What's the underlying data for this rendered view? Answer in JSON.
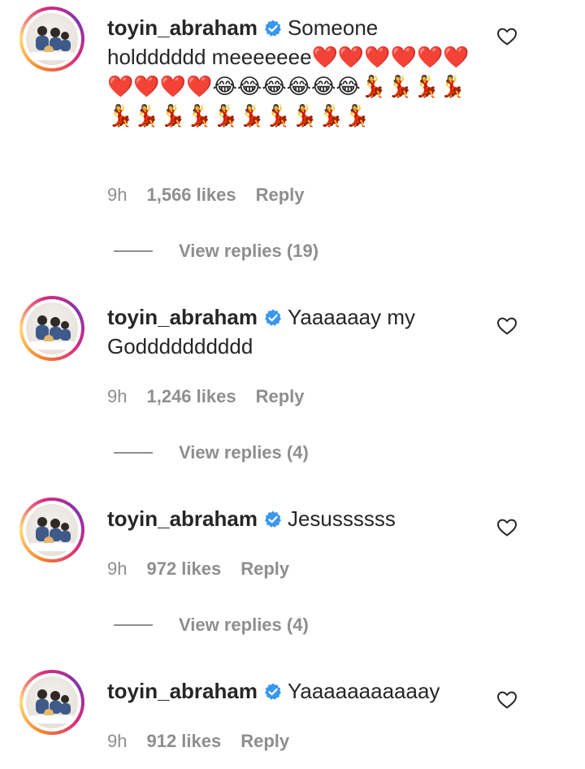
{
  "comments": [
    {
      "username": "toyin_abraham",
      "verified": true,
      "text": "Someone holdddddd meeeeeee❤️❤️❤️❤️❤️❤️❤️❤️❤️❤️😂😂😂😂😂😂💃💃💃💃💃💃💃💃💃💃💃💃💃💃",
      "time": "9h",
      "likes": "1,566 likes",
      "reply_label": "Reply",
      "view_replies": "View replies (19)",
      "like_icon": "heart-outline-icon"
    },
    {
      "username": "toyin_abraham",
      "verified": true,
      "text": "Yaaaaaay my Godddddddddd",
      "time": "9h",
      "likes": "1,246 likes",
      "reply_label": "Reply",
      "view_replies": "View replies (4)",
      "like_icon": "heart-outline-icon"
    },
    {
      "username": "toyin_abraham",
      "verified": true,
      "text": "Jesussssss",
      "time": "9h",
      "likes": "972 likes",
      "reply_label": "Reply",
      "view_replies": "View replies (4)",
      "like_icon": "heart-outline-icon"
    },
    {
      "username": "toyin_abraham",
      "verified": true,
      "text": "Yaaaaaaaaaaay",
      "time": "9h",
      "likes": "912 likes",
      "reply_label": "Reply",
      "like_icon": "heart-outline-icon"
    }
  ],
  "colors": {
    "text": "#262626",
    "secondary": "#8e8e8e",
    "verified_badge": "#3897f0",
    "avatar_ring": [
      "#f58529",
      "#dd2a7b",
      "#8134af"
    ]
  }
}
